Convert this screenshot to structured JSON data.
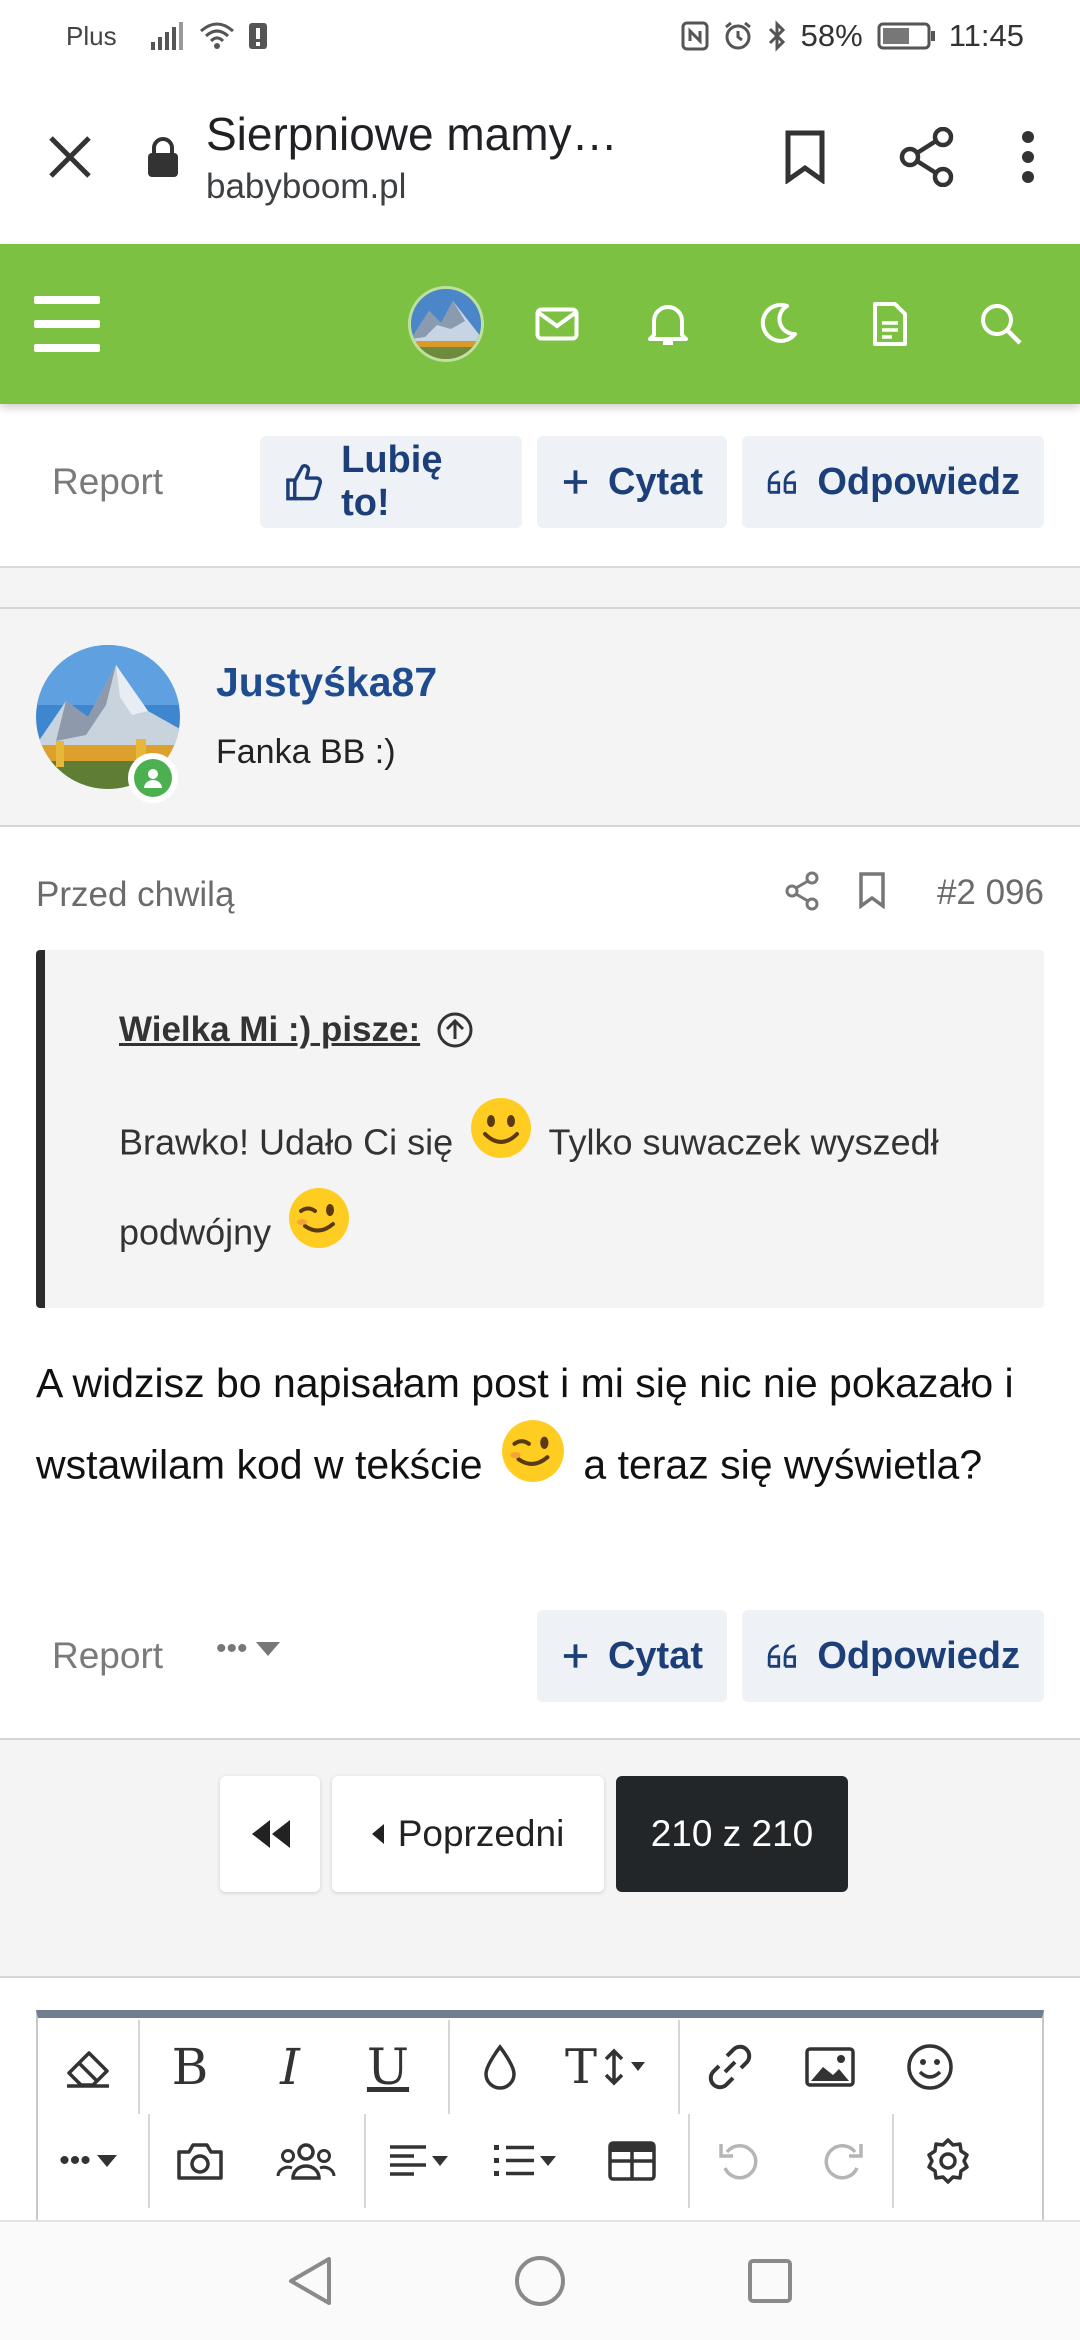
{
  "status_bar": {
    "carrier": "Plus",
    "battery": "58%",
    "time": "11:45"
  },
  "browser": {
    "title": "Sierpniowe mamy…",
    "url": "babyboom.pl"
  },
  "colors": {
    "header_green": "#7dc142",
    "link_blue": "#1f4c8f",
    "button_bg": "#eef1f5",
    "online_green": "#4caf50",
    "pager_current": "#222629"
  },
  "top_actions": {
    "report": "Report",
    "like": "Lubię to!",
    "quote": "Cytat",
    "reply": "Odpowiedz"
  },
  "post": {
    "username": "Justyśka87",
    "user_title": "Fanka BB :)",
    "time": "Przed chwilą",
    "number": "#2 096",
    "quote": {
      "author_line": "Wielka Mi :) pisze:",
      "text_part1": "Brawko! Udało Ci się",
      "text_part2": "Tylko suwaczek wyszedł podwójny"
    },
    "body_part1": "A widzisz bo napisałam post i mi się nic nie pokazało i wstawilam kod w tekście",
    "body_part2": "a teraz się wyświetla?",
    "emojis": [
      "smile-emoji",
      "wink-emoji",
      "wink-emoji"
    ]
  },
  "bottom_actions": {
    "report": "Report",
    "more": "•••",
    "quote": "Cytat",
    "reply": "Odpowiedz"
  },
  "pager": {
    "first_icon": "double-chevron-left-icon",
    "prev": "Poprzedni",
    "current": "210 z 210"
  },
  "editor_toolbar": {
    "row1": [
      "eraser-icon",
      "bold-icon",
      "italic-icon",
      "underline-icon",
      "color-drop-icon",
      "font-size-icon",
      "link-icon",
      "image-icon",
      "emoji-icon"
    ],
    "row2": [
      "more-icon",
      "camera-icon",
      "users-icon",
      "align-icon",
      "list-icon",
      "table-icon",
      "undo-icon",
      "redo-icon",
      "settings-icon"
    ],
    "more_glyph": "•••",
    "bold_glyph": "B",
    "italic_glyph": "I",
    "underline_glyph": "U",
    "fontsize_glyph": "T"
  }
}
